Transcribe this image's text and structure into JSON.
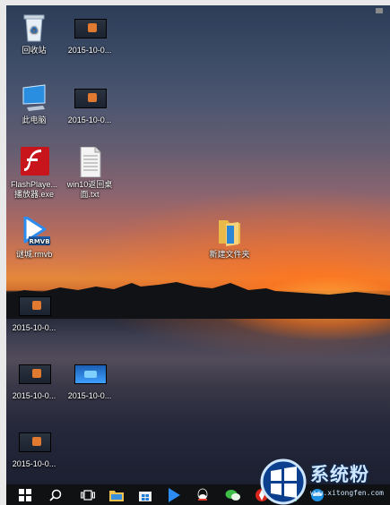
{
  "desktop_icons": [
    {
      "name": "recycle-bin",
      "label": "回收站"
    },
    {
      "name": "video-1",
      "label": "2015-10-0..."
    },
    {
      "name": "this-pc",
      "label": "此电脑"
    },
    {
      "name": "video-2",
      "label": "2015-10-0..."
    },
    {
      "name": "flashplayer",
      "label": "FlashPlaye...\n播放器.exe"
    },
    {
      "name": "text-file",
      "label": "win10返回桌\n面.txt"
    },
    {
      "name": "rmvb-file",
      "label": "谜城.rmvb"
    },
    {
      "name": "new-folder",
      "label": "新建文件夹"
    },
    {
      "name": "video-3",
      "label": "2015-10-0..."
    },
    {
      "name": "video-4",
      "label": "2015-10-0..."
    },
    {
      "name": "video-5",
      "label": "2015-10-0..."
    },
    {
      "name": "video-6",
      "label": "2015-10-0..."
    }
  ],
  "rmvb_badge": "RMVB",
  "taskbar": {
    "items": [
      "start-icon",
      "search-icon",
      "task-view-icon",
      "file-explorer-icon",
      "store-icon",
      "media-player-icon",
      "qq-icon",
      "wechat-icon",
      "app-icon",
      "app-icon-2",
      "edge-icon"
    ]
  },
  "watermark": {
    "text": "系统粉",
    "url": "www.xitongfen.com"
  },
  "colors": {
    "taskbar": "#0f1113",
    "accent": "#1e90ff"
  }
}
